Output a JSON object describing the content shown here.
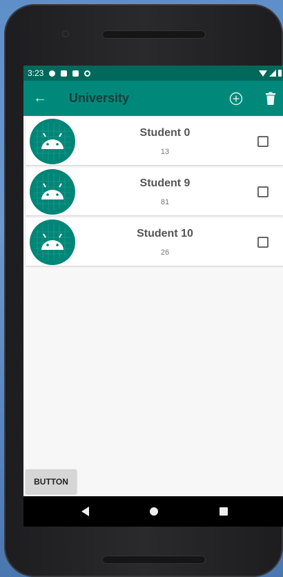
{
  "status_bar": {
    "time": "3:23",
    "icons_left": [
      "gear-icon",
      "shield-icon",
      "sd-card-icon",
      "sync-icon"
    ],
    "icons_right": [
      "wifi-icon",
      "cell-signal-icon",
      "battery-icon"
    ]
  },
  "app_bar": {
    "title": "University",
    "back_icon": "arrow-left-icon",
    "actions": [
      "add-circle-icon",
      "trash-icon"
    ],
    "color": "#00897b",
    "status_color": "#00695c"
  },
  "students": [
    {
      "name": "Student 0",
      "value": "13",
      "checked": false
    },
    {
      "name": "Student 9",
      "value": "81",
      "checked": false
    },
    {
      "name": "Student 10",
      "value": "26",
      "checked": false
    }
  ],
  "footer": {
    "button_label": "BUTTON"
  },
  "nav": [
    "back-icon",
    "home-icon",
    "recents-icon"
  ]
}
